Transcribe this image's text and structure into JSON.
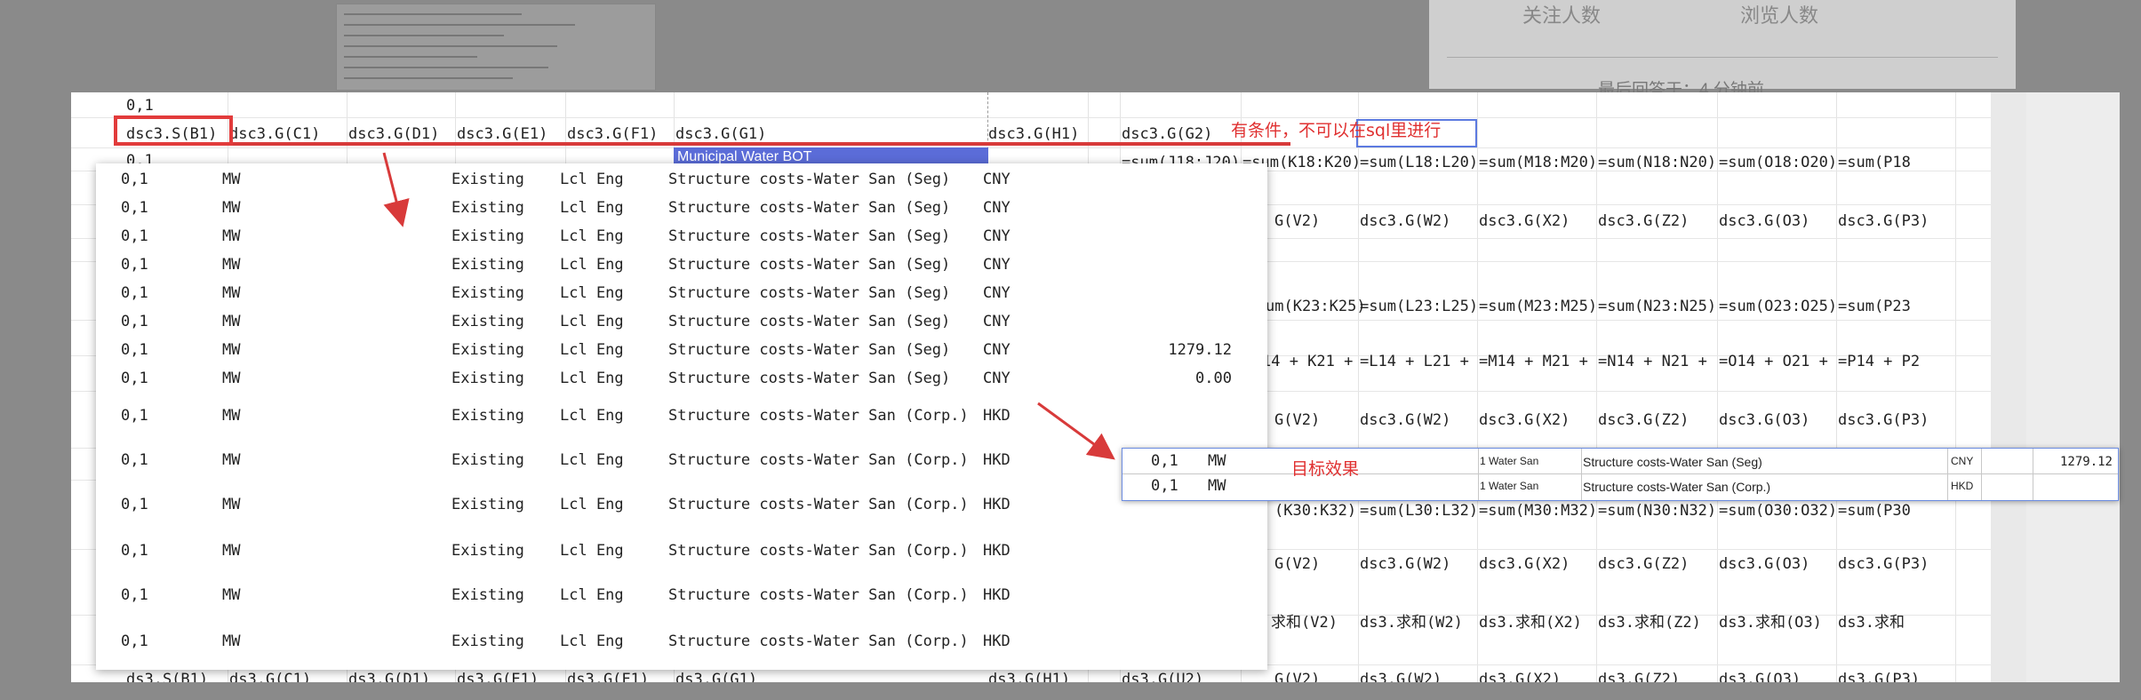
{
  "background": {
    "stats": [
      "关注人数",
      "浏览人数"
    ],
    "subtitle": "最后回答于：4 分钟前"
  },
  "sheet": {
    "row_label_top": "0,1",
    "header_row": [
      "dsc3.S(B1)",
      "dsc3.G(C1)",
      "dsc3.G(D1)",
      "dsc3.G(E1)",
      "dsc3.G(F1)",
      "dsc3.G(G1)",
      "dsc3.G(H1)",
      "dsc3.G(G2)"
    ],
    "blue_cell": "Municipal Water BOT",
    "annotation_note": "有条件，不可以在sql里进行",
    "row_under_header": "0,1",
    "right_rows": [
      [
        "=sum(J18:J20)",
        "=sum(K18:K20)",
        "=sum(L18:L20)",
        "=sum(M18:M20)",
        "=sum(N18:N20)",
        "=sum(O18:O20)",
        "=sum(P18"
      ],
      [
        "",
        "G(V2)",
        "dsc3.G(W2)",
        "dsc3.G(X2)",
        "dsc3.G(Z2)",
        "dsc3.G(O3)",
        "dsc3.G(P3)"
      ],
      [
        "",
        "um(K23:K25)",
        "=sum(L23:L25)",
        "=sum(M23:M25)",
        "=sum(N23:N25)",
        "=sum(O23:O25)",
        "=sum(P23"
      ],
      [
        "",
        "14 + K21 +",
        "=L14 + L21 +",
        "=M14 + M21 +",
        "=N14 + N21 +",
        "=O14 + O21 +",
        "=P14 + P2"
      ],
      [
        "",
        "G(V2)",
        "dsc3.G(W2)",
        "dsc3.G(X2)",
        "dsc3.G(Z2)",
        "dsc3.G(O3)",
        "dsc3.G(P3)"
      ],
      [
        "",
        "(K30:K32)",
        "=sum(L30:L32)",
        "=sum(M30:M32)",
        "=sum(N30:N32)",
        "=sum(O30:O32)",
        "=sum(P30"
      ],
      [
        "",
        "G(V2)",
        "dsc3.G(W2)",
        "dsc3.G(X2)",
        "dsc3.G(Z2)",
        "dsc3.G(O3)",
        "dsc3.G(P3)"
      ],
      [
        "",
        "求和(V2)",
        "ds3.求和(W2)",
        "ds3.求和(X2)",
        "ds3.求和(Z2)",
        "ds3.求和(O3)",
        "ds3.求和"
      ]
    ],
    "bottom_row": [
      "ds3.S(B1)",
      "ds3.G(C1)",
      "ds3.G(D1)",
      "ds3.G(E1)",
      "ds3.G(F1)",
      "ds3.G(G1)",
      "ds3.G(H1)",
      "ds3.G(U2)",
      "G(V2)",
      "ds3.G(W2)",
      "ds3.G(X2)",
      "ds3.G(Z2)",
      "ds3.G(O3)",
      "ds3.G(P3)"
    ]
  },
  "popup": {
    "rows": [
      {
        "a": "0,1",
        "b": "MW",
        "c": "Existing",
        "d": "Lcl Eng",
        "e": "Structure costs-Water San (Seg)",
        "f": "CNY",
        "g": ""
      },
      {
        "a": "0,1",
        "b": "MW",
        "c": "Existing",
        "d": "Lcl Eng",
        "e": "Structure costs-Water San (Seg)",
        "f": "CNY",
        "g": ""
      },
      {
        "a": "0,1",
        "b": "MW",
        "c": "Existing",
        "d": "Lcl Eng",
        "e": "Structure costs-Water San (Seg)",
        "f": "CNY",
        "g": ""
      },
      {
        "a": "0,1",
        "b": "MW",
        "c": "Existing",
        "d": "Lcl Eng",
        "e": "Structure costs-Water San (Seg)",
        "f": "CNY",
        "g": ""
      },
      {
        "a": "0,1",
        "b": "MW",
        "c": "Existing",
        "d": "Lcl Eng",
        "e": "Structure costs-Water San (Seg)",
        "f": "CNY",
        "g": ""
      },
      {
        "a": "0,1",
        "b": "MW",
        "c": "Existing",
        "d": "Lcl Eng",
        "e": "Structure costs-Water San (Seg)",
        "f": "CNY",
        "g": ""
      },
      {
        "a": "0,1",
        "b": "MW",
        "c": "Existing",
        "d": "Lcl Eng",
        "e": "Structure costs-Water San (Seg)",
        "f": "CNY",
        "g": "1279.12"
      },
      {
        "a": "0,1",
        "b": "MW",
        "c": "Existing",
        "d": "Lcl Eng",
        "e": "Structure costs-Water San (Seg)",
        "f": "CNY",
        "g": "0.00"
      },
      {
        "a": "0,1",
        "b": "MW",
        "c": "Existing",
        "d": "Lcl Eng",
        "e": "Structure costs-Water San (Corp.)",
        "f": "HKD",
        "g": ""
      },
      {
        "a": "0,1",
        "b": "MW",
        "c": "Existing",
        "d": "Lcl Eng",
        "e": "Structure costs-Water San (Corp.)",
        "f": "HKD",
        "g": ""
      },
      {
        "a": "0,1",
        "b": "MW",
        "c": "Existing",
        "d": "Lcl Eng",
        "e": "Structure costs-Water San (Corp.)",
        "f": "HKD",
        "g": ""
      },
      {
        "a": "0,1",
        "b": "MW",
        "c": "Existing",
        "d": "Lcl Eng",
        "e": "Structure costs-Water San (Corp.)",
        "f": "HKD",
        "g": ""
      },
      {
        "a": "0,1",
        "b": "MW",
        "c": "Existing",
        "d": "Lcl Eng",
        "e": "Structure costs-Water San (Corp.)",
        "f": "HKD",
        "g": ""
      },
      {
        "a": "0,1",
        "b": "MW",
        "c": "Existing",
        "d": "Lcl Eng",
        "e": "Structure costs-Water San (Corp.)",
        "f": "HKD",
        "g": ""
      }
    ]
  },
  "target": {
    "label": "目标效果",
    "rows": [
      {
        "a": "0,1",
        "b": "MW",
        "c": "1 Water San",
        "d": "Structure costs-Water San (Seg)",
        "e": "CNY",
        "f": "1279.12"
      },
      {
        "a": "0,1",
        "b": "MW",
        "c": "1 Water San",
        "d": "Structure costs-Water San (Corp.)",
        "e": "HKD",
        "f": ""
      }
    ]
  },
  "colors": {
    "accent_red": "#e03030",
    "selection_blue": "#5b6cd8"
  }
}
